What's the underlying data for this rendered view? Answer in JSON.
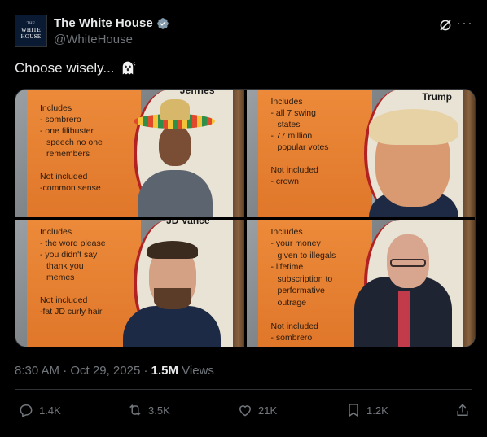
{
  "account": {
    "display_name": "The White House",
    "handle": "@WhiteHouse",
    "avatar_text": [
      "THE",
      "WHITE",
      "HOUSE"
    ]
  },
  "post": {
    "text": "Choose wisely...",
    "emoji": "ghost-emoji"
  },
  "media": {
    "cards": [
      {
        "banner": "Jeffries",
        "lines": [
          "Includes",
          "- sombrero",
          "- one filibuster",
          "  speech no one",
          "  remembers",
          "",
          "Not included",
          "-common sense"
        ]
      },
      {
        "banner": "Trump",
        "lines": [
          "Includes",
          "- all 7 swing",
          "  states",
          "- 77 million",
          "  popular votes",
          "",
          "Not included",
          "- crown"
        ]
      },
      {
        "banner": "JD Vance",
        "lines": [
          "Includes",
          "- the word please",
          "- you didn't say",
          "  thank you",
          "  memes",
          "",
          "Not included",
          "-fat JD curly hair"
        ]
      },
      {
        "banner": "",
        "lines": [
          "Includes",
          "- your money",
          "  given to illegals",
          "- lifetime",
          "  subscription to",
          "  performative",
          "  outrage",
          "",
          "Not included",
          "- sombrero"
        ]
      }
    ]
  },
  "meta": {
    "time": "8:30 AM",
    "date": "Oct 29, 2025",
    "separator": "·",
    "views_count": "1.5M",
    "views_label": "Views"
  },
  "actions": {
    "replies": "1.4K",
    "reposts": "3.5K",
    "likes": "21K",
    "bookmarks": "1.2K"
  },
  "colors": {
    "background": "#000000",
    "text_primary": "#e7e9ea",
    "text_secondary": "#71767b",
    "verified": "#829aab",
    "divider": "#2f3336"
  }
}
